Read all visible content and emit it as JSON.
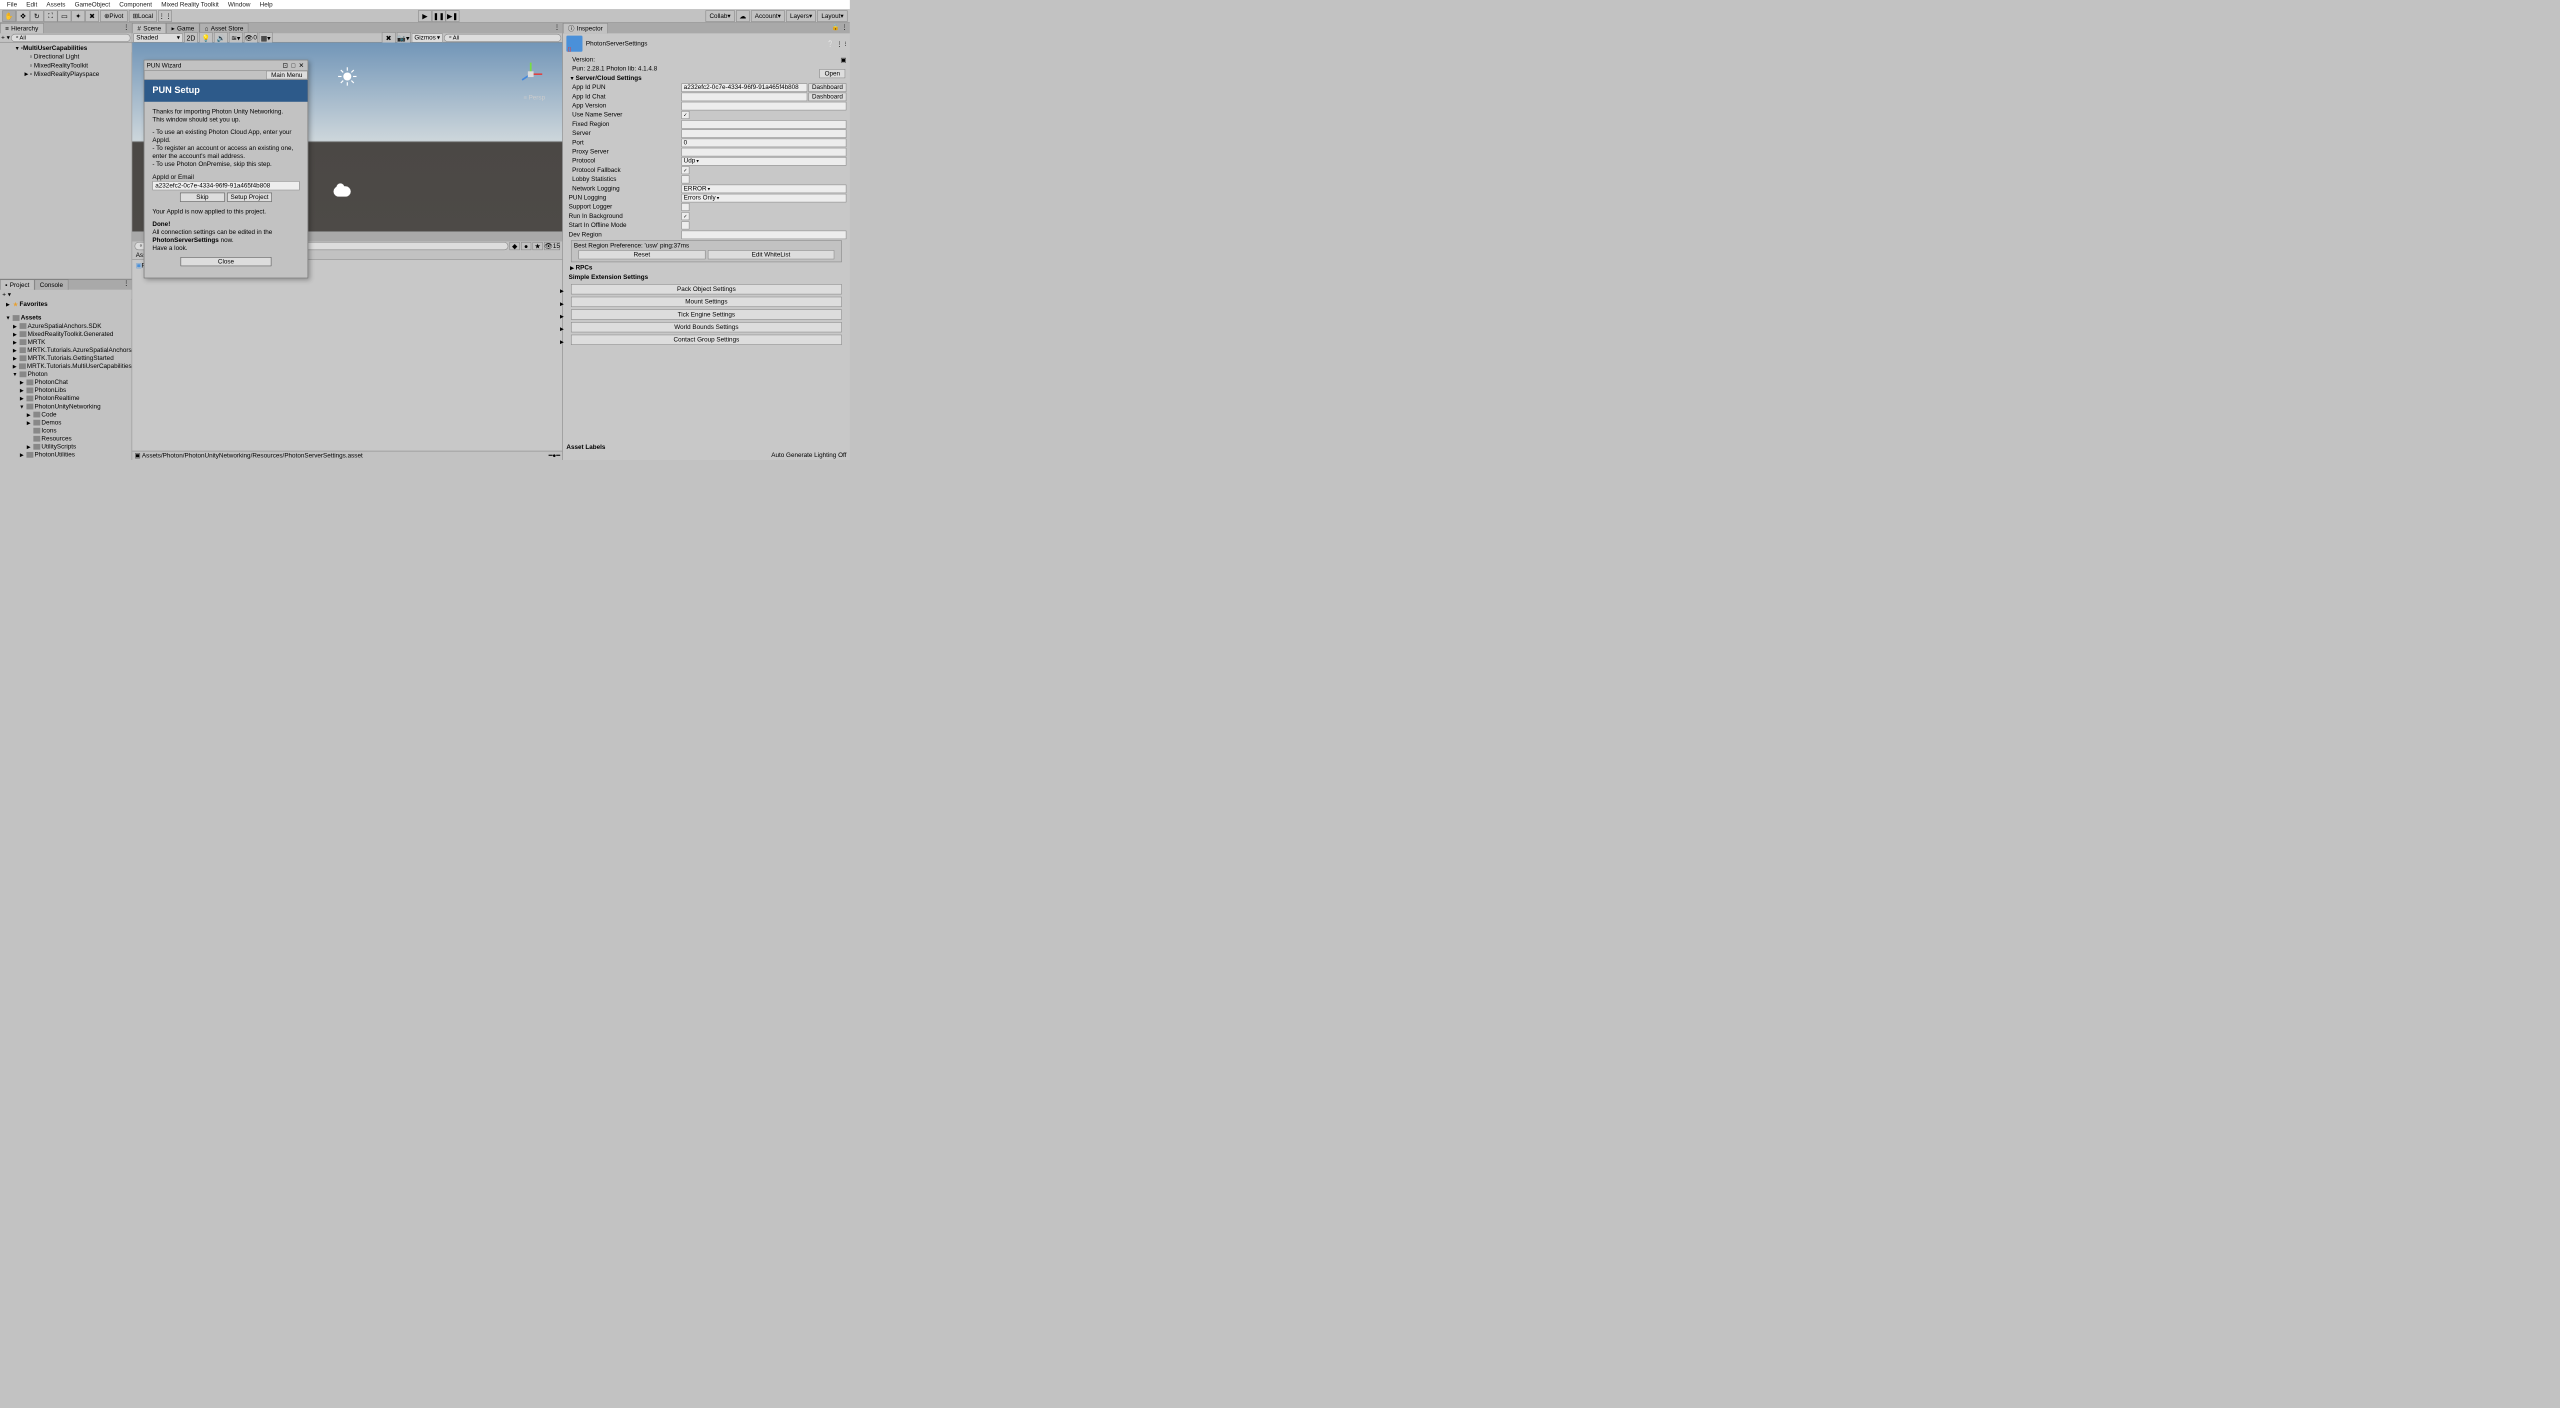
{
  "menu": [
    "File",
    "Edit",
    "Assets",
    "GameObject",
    "Component",
    "Mixed Reality Toolkit",
    "Window",
    "Help"
  ],
  "pivot": "Pivot",
  "local": "Local",
  "collab": "Collab",
  "account": "Account",
  "layers": "Layers",
  "layout": "Layout",
  "hierarchy": {
    "title": "Hierarchy",
    "search_ph": "All",
    "items": [
      {
        "name": "MultiUserCapabilities",
        "bold": true,
        "indent": 1,
        "arrow": "▼"
      },
      {
        "name": "Directional Light",
        "indent": 2
      },
      {
        "name": "MixedRealityToolkit",
        "indent": 2
      },
      {
        "name": "MixedRealityPlayspace",
        "indent": 2,
        "arrow": "▶"
      }
    ]
  },
  "scene": {
    "tabs": [
      "Scene",
      "Game",
      "Asset Store"
    ],
    "shading": "Shaded",
    "twod": "2D",
    "gizmos": "Gizmos",
    "zero": "0",
    "persp": "Persp"
  },
  "wizard": {
    "title": "PUN Wizard",
    "mainmenu": "Main Menu",
    "header": "PUN Setup",
    "intro1": "Thanks for importing Photon Unity Networking.",
    "intro2": "This window should set you up.",
    "b1": "- To use an existing Photon Cloud App, enter your AppId.",
    "b2": "- To register an account or access an existing one, enter the account's mail address.",
    "b3": "- To use Photon OnPremise, skip this step.",
    "appid_label": "AppId or Email",
    "appid": "a232efc2-0c7e-4334-96f9-91a465f4b808",
    "skip": "Skip",
    "setup": "Setup Project",
    "applied": "Your AppId is now applied to this project.",
    "done": "Done!",
    "done1": "All connection settings can be edited in the",
    "done2": "PhotonServerSettings",
    "done3": " now.",
    "havelook": "Have a look.",
    "close": "Close"
  },
  "project": {
    "title": "Project",
    "console": "Console",
    "favorites": "Favorites",
    "assets": "Assets",
    "tree": [
      {
        "n": "AzureSpatialAnchors.SDK",
        "l": 2,
        "t": "▶"
      },
      {
        "n": "MixedRealityToolkit.Generated",
        "l": 2,
        "t": "▶"
      },
      {
        "n": "MRTK",
        "l": 2,
        "t": "▶"
      },
      {
        "n": "MRTK.Tutorials.AzureSpatialAnchors",
        "l": 2,
        "t": "▶"
      },
      {
        "n": "MRTK.Tutorials.GettingStarted",
        "l": 2,
        "t": "▶"
      },
      {
        "n": "MRTK.Tutorials.MultiUserCapabilities",
        "l": 2,
        "t": "▶"
      },
      {
        "n": "Photon",
        "l": 2,
        "t": "▼"
      },
      {
        "n": "PhotonChat",
        "l": 3,
        "t": "▶"
      },
      {
        "n": "PhotonLibs",
        "l": 3,
        "t": "▶"
      },
      {
        "n": "PhotonRealtime",
        "l": 3,
        "t": "▶"
      },
      {
        "n": "PhotonUnityNetworking",
        "l": 3,
        "t": "▼"
      },
      {
        "n": "Code",
        "l": 4,
        "t": "▶"
      },
      {
        "n": "Demos",
        "l": 4,
        "t": "▶"
      },
      {
        "n": "Icons",
        "l": 4,
        "t": ""
      },
      {
        "n": "Resources",
        "l": 4,
        "t": ""
      },
      {
        "n": "UtilityScripts",
        "l": 4,
        "t": "▶"
      },
      {
        "n": "PhotonUtilities",
        "l": 3,
        "t": "▶"
      }
    ],
    "hidden": "15",
    "breadcrumb": "Assets  ›  Photon  ›  PhotonUnityNetworking  ›  Resources",
    "asset": "PhotonServerSettings",
    "footer": "Assets/Photon/PhotonUnityNetworking/Resources/PhotonServerSettings.asset"
  },
  "inspector": {
    "title": "Inspector",
    "name": "PhotonServerSettings",
    "open": "Open",
    "version_l": "Version:",
    "pun": "Pun: 2.28.1 Photon lib: 4.1.4.8",
    "section": "Server/Cloud Settings",
    "rows": [
      {
        "l": "App Id PUN",
        "v": "a232efc2-0c7e-4334-96f9-91a465f4b808",
        "btn": "Dashboard"
      },
      {
        "l": "App Id Chat",
        "v": "",
        "btn": "Dashboard"
      },
      {
        "l": "App Version",
        "v": ""
      },
      {
        "l": "Use Name Server",
        "chk": true
      },
      {
        "l": "Fixed Region",
        "v": ""
      },
      {
        "l": "Server",
        "v": ""
      },
      {
        "l": "Port",
        "v": "0"
      },
      {
        "l": "Proxy Server",
        "v": ""
      },
      {
        "l": "Protocol",
        "v": "Udp",
        "dd": true
      },
      {
        "l": "Protocol Fallback",
        "chk": true
      },
      {
        "l": "Lobby Statistics",
        "chk": false
      },
      {
        "l": "Network Logging",
        "v": "ERROR",
        "dd": true
      }
    ],
    "punlog_l": "PUN Logging",
    "punlog_v": "Errors Only",
    "extras": [
      {
        "l": "Support Logger",
        "chk": false
      },
      {
        "l": "Run In Background",
        "chk": true
      },
      {
        "l": "Start In Offline Mode",
        "chk": false
      },
      {
        "l": "Dev Region",
        "v": ""
      }
    ],
    "region": "Best Region Preference: 'usw' ping:37ms",
    "reset": "Reset",
    "whitelist": "Edit WhiteList",
    "rpcs": "RPCs",
    "ext_hdr": "Simple Extension Settings",
    "ext": [
      "Pack Object Settings",
      "Mount Settings",
      "Tick Engine Settings",
      "World Bounds Settings",
      "Contact Group Settings"
    ],
    "labels": "Asset Labels",
    "status": "Auto Generate Lighting Off"
  }
}
